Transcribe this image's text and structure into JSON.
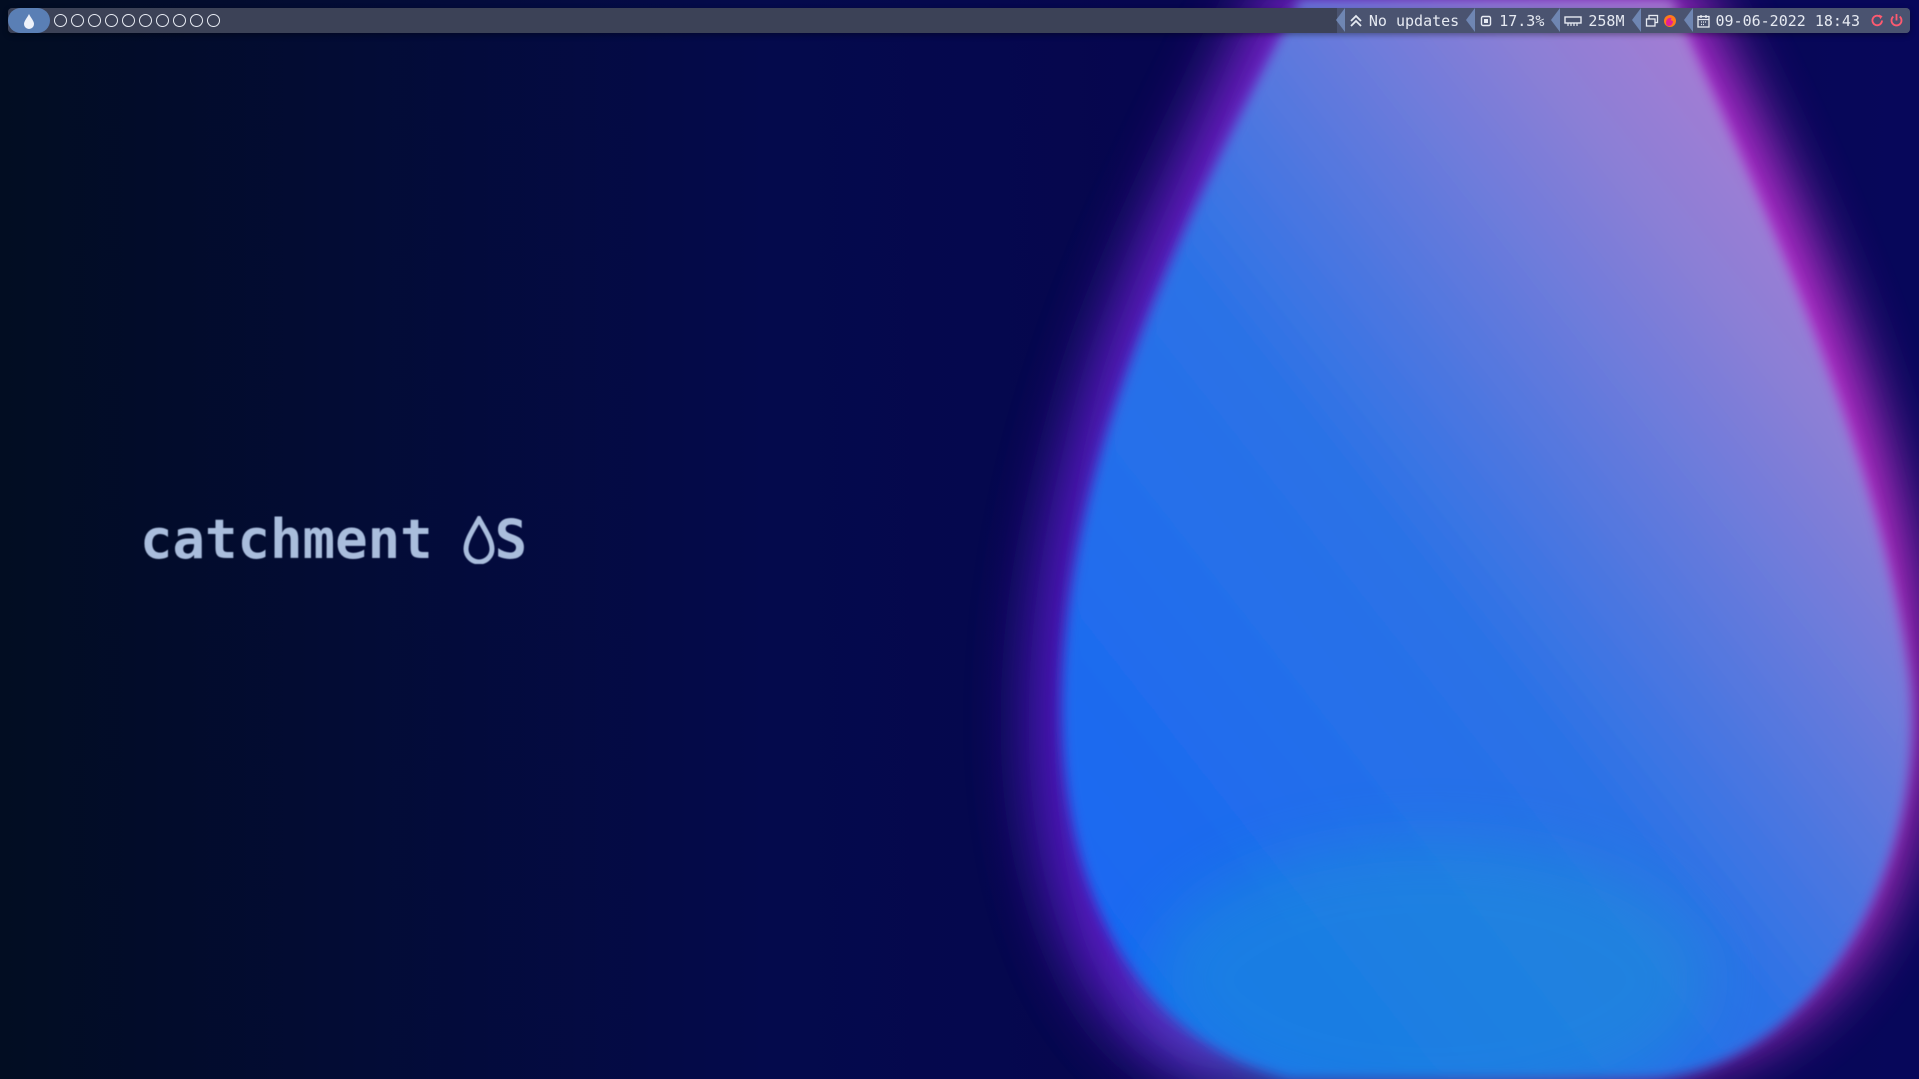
{
  "wallpaper": {
    "brand_text": "catchment",
    "brand_suffix": "S",
    "drop_icon": "water-drop-icon",
    "colors": {
      "background_dark": "#040a4c",
      "drop_blue": "#1466f5",
      "drop_pink": "#e36bd9",
      "text": "#a9bddc"
    }
  },
  "bar": {
    "logo_icon": "water-drop-icon",
    "workspaces": [
      "",
      "",
      "",
      "",
      "",
      "",
      "",
      "",
      "",
      ""
    ],
    "updates": {
      "icon": "chevron-up-double-icon",
      "label": "No updates"
    },
    "cpu": {
      "icon": "cpu-chip-icon",
      "value": "17.3%"
    },
    "memory": {
      "icon": "memory-icon",
      "value": "258M"
    },
    "windows": {
      "icon": "window-stack-icon",
      "app_icon": "firefox-icon"
    },
    "datetime": {
      "icon": "calendar-icon",
      "value": "09-06-2022 18:43"
    },
    "power": {
      "restart_icon": "restart-icon",
      "shutdown_icon": "power-icon"
    },
    "colors": {
      "bar": "#3c4257",
      "accent": "#5a7fb5",
      "text": "#e6eaf2",
      "restart": "#ff5a70"
    }
  }
}
